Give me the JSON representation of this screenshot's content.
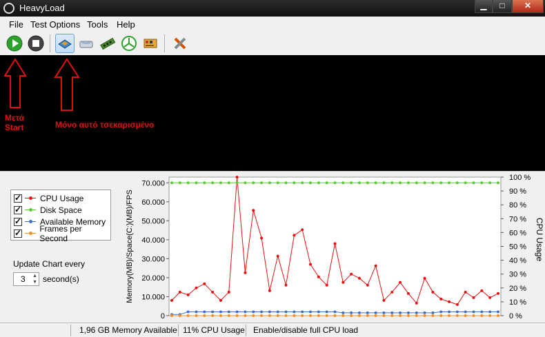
{
  "window": {
    "title": "HeavyLoad",
    "minimize": "▁",
    "maximize": "□",
    "close": "✕"
  },
  "menu": {
    "items": [
      "File",
      "Test Options",
      "Tools",
      "Help"
    ]
  },
  "toolbar": {
    "buttons": [
      {
        "name": "start-icon",
        "color": "#2ea22e"
      },
      {
        "name": "stop-icon",
        "color": "#444444"
      },
      {
        "name": "cpu-test-icon",
        "selected": true
      },
      {
        "name": "disk-test-icon"
      },
      {
        "name": "memory-test-icon"
      },
      {
        "name": "gpu-test-icon"
      },
      {
        "name": "file-tree-icon"
      },
      {
        "name": "tools-icon"
      }
    ]
  },
  "annotations": {
    "start_note_line1": "Μετά",
    "start_note_line2": "Start",
    "cpu_note": "Μόνο αυτό τσεκαρισμένο",
    "color": "#e01010"
  },
  "legend": {
    "items": [
      {
        "label": "CPU Usage",
        "color": "#e81010",
        "checked": true
      },
      {
        "label": "Disk Space",
        "color": "#5cc836",
        "checked": true
      },
      {
        "label": "Available Memory",
        "color": "#3f72c4",
        "checked": true
      },
      {
        "label": "Frames per Second",
        "color": "#f0902a",
        "checked": true
      }
    ]
  },
  "update": {
    "label": "Update Chart every",
    "value": "3",
    "unit": "second(s)"
  },
  "status": {
    "memory": "1,96 GB Memory Available",
    "cpu": "11% CPU Usage",
    "hint": "Enable/disable full CPU load"
  },
  "chart_data": {
    "type": "line",
    "ylabel_left": "Memory(MB)/Space(C:)(MB)/FPS",
    "ylabel_right": "CPU Usage",
    "left_ticks": [
      "0",
      "10.000",
      "20.000",
      "30.000",
      "40.000",
      "50.000",
      "60.000",
      "70.000"
    ],
    "right_ticks": [
      "0 %",
      "10 %",
      "20 %",
      "30 %",
      "40 %",
      "50 %",
      "60 %",
      "70 %",
      "80 %",
      "90 %",
      "100 %"
    ],
    "ylim_left": [
      0,
      73000
    ],
    "ylim_right": [
      0,
      100
    ],
    "grid": false,
    "series": [
      {
        "name": "CPU Usage",
        "axis": "right",
        "color": "#e81010",
        "values": [
          11,
          17,
          15,
          20,
          23,
          17,
          11,
          17,
          100,
          31,
          76,
          56,
          18,
          43,
          22,
          58,
          62,
          37,
          28,
          22,
          52,
          24,
          30,
          27,
          22,
          36,
          11,
          17,
          24,
          16,
          9,
          27,
          17,
          12,
          10,
          8,
          17,
          13,
          18,
          13,
          16
        ]
      },
      {
        "name": "Disk Space",
        "axis": "left",
        "color": "#5cc836",
        "values": [
          70000,
          70000,
          70000,
          70000,
          70000,
          70000,
          70000,
          70000,
          70000,
          70000,
          70000,
          70000,
          70000,
          70000,
          70000,
          70000,
          70000,
          70000,
          70000,
          70000,
          70000,
          70000,
          70000,
          70000,
          70000,
          70000,
          70000,
          70000,
          70000,
          70000,
          70000,
          70000,
          70000,
          70000,
          70000,
          70000,
          70000,
          70000,
          70000,
          70000,
          70000
        ]
      },
      {
        "name": "Available Memory",
        "axis": "left",
        "color": "#3f72c4",
        "values": [
          600,
          600,
          2000,
          2000,
          2000,
          2000,
          2000,
          2000,
          2000,
          2000,
          2000,
          2000,
          2000,
          2000,
          2000,
          2000,
          2000,
          2000,
          2000,
          2000,
          2000,
          1500,
          1500,
          1500,
          1500,
          1500,
          1500,
          1500,
          1500,
          1500,
          1500,
          1500,
          1500,
          2000,
          2000,
          2000,
          2000,
          2000,
          2000,
          2000,
          2000
        ]
      },
      {
        "name": "Frames per Second",
        "axis": "left",
        "color": "#f0902a",
        "values": [
          0,
          0,
          0,
          0,
          0,
          0,
          0,
          0,
          0,
          0,
          0,
          0,
          0,
          0,
          0,
          0,
          0,
          0,
          0,
          0,
          0,
          0,
          0,
          0,
          0,
          0,
          0,
          0,
          0,
          0,
          0,
          0,
          0,
          0,
          0,
          0,
          0,
          0,
          0,
          0,
          0
        ]
      }
    ]
  }
}
